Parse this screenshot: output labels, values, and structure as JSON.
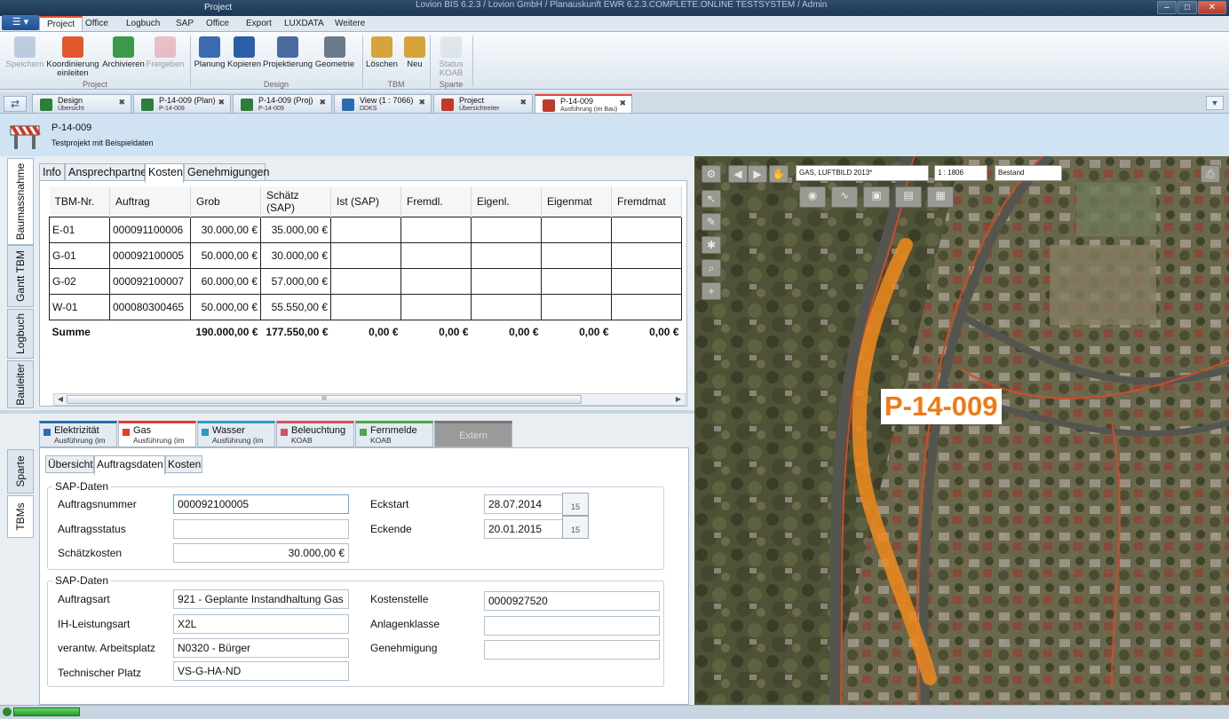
{
  "window": {
    "ribbon_context": "Project",
    "path_title": "Lovion BIS 6.2.3 / Lovion GmbH / Planauskunft EWR 6.2.3.COMPLETE.ONLINE TESTSYSTEM / Admin"
  },
  "ribbon_tabs": [
    "Project",
    "Office",
    "Logbuch",
    "SAP",
    "Office",
    "Export",
    "LUXDATA",
    "Weitere Funktionen"
  ],
  "ribbon": {
    "buttons": [
      {
        "label": "Speichern",
        "disabled": true,
        "icon": "save-icon"
      },
      {
        "label": "Koordinierung einleiten",
        "icon": "traffic-cone-icon"
      },
      {
        "label": "Archivieren",
        "icon": "archive-icon"
      },
      {
        "label": "Freigeben",
        "disabled": true,
        "icon": "release-icon"
      },
      {
        "label": "Planung",
        "icon": "planning-icon"
      },
      {
        "label": "Kopieren",
        "icon": "copy-icon"
      },
      {
        "label": "Projektierung",
        "icon": "projecting-icon"
      },
      {
        "label": "Geometrie",
        "icon": "geometry-icon"
      },
      {
        "label": "Löschen",
        "icon": "delete-icon"
      },
      {
        "label": "Neu",
        "icon": "new-icon"
      },
      {
        "label": "Status KOAB",
        "disabled": true,
        "icon": "status-flag-icon"
      }
    ],
    "groups": [
      "Project",
      "Design",
      "TBM",
      "Sparte"
    ]
  },
  "doc_tabs": [
    {
      "title": "Design",
      "sub": "Übersicht",
      "color": "#2e7d3a"
    },
    {
      "title": "P-14-009 (Plan)",
      "sub": "P-14-009",
      "color": "#2e7d3a"
    },
    {
      "title": "P-14-009 (Proj)",
      "sub": "P-14-009",
      "color": "#2e7d3a"
    },
    {
      "title": "View (1 : 7066)",
      "sub": "DDKS",
      "color": "#2b6cb0"
    },
    {
      "title": "Project",
      "sub": "Übersichtreiter",
      "color": "#c0392b"
    },
    {
      "title": "P-14-009",
      "sub": "Ausführung (im Bau)",
      "color": "#c0392b",
      "active": true
    }
  ],
  "project": {
    "id": "P-14-009",
    "description": "Testprojekt mit Beispieldaten"
  },
  "left_vtabs": [
    "Baumassnahme",
    "Gantt TBM",
    "Logbuch",
    "Bauleiter"
  ],
  "panel_tabs": [
    "Info",
    "Ansprechpartner",
    "Kosten",
    "Genehmigungen"
  ],
  "costs": {
    "columns": [
      "TBM-Nr.",
      "Auftrag",
      "Grob",
      "Schätz (SAP)",
      "Ist (SAP)",
      "Fremdl.",
      "Eigenl.",
      "Eigenmat",
      "Fremdmat"
    ],
    "rows": [
      [
        "E-01",
        "000091100006",
        "30.000,00 €",
        "35.000,00 €",
        "",
        "",
        "",
        "",
        ""
      ],
      [
        "G-01",
        "000092100005",
        "50.000,00 €",
        "30.000,00 €",
        "",
        "",
        "",
        "",
        ""
      ],
      [
        "G-02",
        "000092100007",
        "60.000,00 €",
        "57.000,00 €",
        "",
        "",
        "",
        "",
        ""
      ],
      [
        "W-01",
        "000080300465",
        "50.000,00 €",
        "55.550,00 €",
        "",
        "",
        "",
        "",
        ""
      ]
    ],
    "sum_row": [
      "Summe",
      "",
      "190.000,00 €",
      "177.550,00 €",
      "0,00 €",
      "0,00 €",
      "0,00 €",
      "0,00 €",
      "0,00 €"
    ],
    "scroll_grip": "III"
  },
  "bottom_vtabs": [
    "Sparte",
    "TBMs"
  ],
  "sparten": [
    {
      "name": "Elektrizität",
      "sub": "Ausführung (im Bau)",
      "color": "#2a6db3"
    },
    {
      "name": "Gas",
      "sub": "Ausführung (im Bau)",
      "color": "#e03c2b",
      "active": true
    },
    {
      "name": "Wasser",
      "sub": "Ausführung (im Bau)",
      "color": "#2a9bc7"
    },
    {
      "name": "Beleuchtung",
      "sub": "KOAB",
      "color": "#d85060"
    },
    {
      "name": "Fernmelde",
      "sub": "KOAB",
      "color": "#4aa84a"
    },
    {
      "name": "Extern",
      "sub": "",
      "color": "#777",
      "disabled": true
    }
  ],
  "detail_tabs": [
    "Übersicht",
    "Auftragsdaten",
    "Kosten"
  ],
  "sap1": {
    "legend": "SAP-Daten",
    "auftragsnummer_label": "Auftragsnummer",
    "auftragsnummer": "000092100005",
    "auftragsstatus_label": "Auftragsstatus",
    "auftragsstatus": "",
    "schaetzkosten_label": "Schätzkosten",
    "schaetzkosten": "30.000,00 €",
    "eckstart_label": "Eckstart",
    "eckstart": "28.07.2014",
    "eckende_label": "Eckende",
    "eckende": "20.01.2015",
    "calendar_day": "15"
  },
  "sap2": {
    "legend": "SAP-Daten",
    "auftragsart_label": "Auftragsart",
    "auftragsart": "921 - Geplante Instandhaltung Gas",
    "ih_label": "IH-Leistungsart",
    "ih": "X2L",
    "arbeitsplatz_label": "verantw. Arbeitsplatz",
    "arbeitsplatz": "N0320 - Bürger",
    "techplatz_label": "Technischer Platz",
    "techplatz": "VS-G-HA-ND",
    "kostenstelle_label": "Kostenstelle",
    "kostenstelle": "0000927520",
    "anlagenklasse_label": "Anlagenklasse",
    "anlagenklasse": "",
    "genehmigung_label": "Genehmigung",
    "genehmigung": ""
  },
  "map": {
    "layer": "GAS, LUFTBILD 2013*",
    "scale": "1 : 1806",
    "state": "Bestand",
    "project_label": "P-14-009",
    "route_color": "#f08a1c"
  }
}
